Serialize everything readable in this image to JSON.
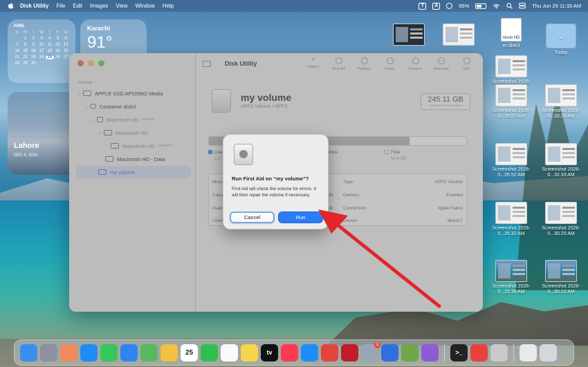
{
  "menubar": {
    "app_name": "Disk Utility",
    "items": [
      "File",
      "Edit",
      "Images",
      "View",
      "Window",
      "Help"
    ],
    "input_badge_1": "T",
    "input_badge_2": "A",
    "battery": "55%",
    "datetime": "Thu Jun 25  11:33 AM"
  },
  "widgets": {
    "calendar": {
      "month": "JUNE",
      "weekdays": [
        "S",
        "M",
        "T",
        "W",
        "T",
        "F",
        "S"
      ],
      "rows": [
        [
          "",
          "1",
          "2",
          "3",
          "4",
          "5",
          "6"
        ],
        [
          "7",
          "8",
          "9",
          "10",
          "11",
          "12",
          "13"
        ],
        [
          "14",
          "15",
          "16",
          "17",
          "18",
          "19",
          "20"
        ],
        [
          "21",
          "22",
          "23",
          "24",
          "25",
          "26",
          "27"
        ],
        [
          "28",
          "29",
          "30",
          "",
          "",
          "",
          ""
        ]
      ],
      "today": "25"
    },
    "weather": {
      "city": "Karachi",
      "temp": "91°"
    },
    "photo": {
      "place": "Lahore",
      "date": "DEC 4, 2023"
    }
  },
  "desktop_icons": [
    {
      "label": "",
      "kind": "thumb-dark"
    },
    {
      "label": "",
      "kind": "thumb"
    },
    {
      "label": "er disk3",
      "kind": "doc",
      "doc_label": "ntosh HD"
    },
    {
      "label": "Today",
      "kind": "folder"
    },
    {
      "label": "Screenshot 2026-0...30.02 AM",
      "kind": "thumb"
    },
    {
      "label": "Screenshot 2026-0...26.57 AM",
      "kind": "thumb"
    },
    {
      "label": "Screenshot 2026-0...33.24 AM",
      "kind": "thumb"
    },
    {
      "label": "Screenshot 2026-0...26.52 AM",
      "kind": "thumb"
    },
    {
      "label": "Screenshot 2026-0...32.33 AM",
      "kind": "thumb"
    },
    {
      "label": "Screenshot 2026-0...26.32 AM",
      "kind": "thumb"
    },
    {
      "label": "Screenshot 2026-0...30.20 AM",
      "kind": "thumb"
    },
    {
      "label": "Screenshot 2026-0...25.38 AM",
      "kind": "thumb-scene"
    },
    {
      "label": "Screenshot 2026-0...30.10 AM",
      "kind": "thumb-scene"
    }
  ],
  "window": {
    "title": "Disk Utility",
    "sidebar": {
      "section": "Internal",
      "items": [
        {
          "label": "APPLE SSD AP0256Q Media",
          "tag": ""
        },
        {
          "label": "Container disk3",
          "tag": ""
        },
        {
          "label": "Macintosh HD",
          "tag": "volumes"
        },
        {
          "label": "Macintosh HD",
          "tag": ""
        },
        {
          "label": "Macintosh HD",
          "tag": "snapshot"
        },
        {
          "label": "Macintosh HD - Data",
          "tag": ""
        },
        {
          "label": "my volume",
          "tag": ""
        }
      ]
    },
    "toolbar_tools": [
      "Volume",
      "First Aid",
      "Partition",
      "Erase",
      "Restore",
      "Unmount",
      "Info"
    ],
    "volume": {
      "name": "my volume",
      "subtitle": "APFS Volume • APFS",
      "capacity": "245.11 GB",
      "shared": "SHARED BY 6 VOLUMES"
    },
    "usage": {
      "used_fraction": 0.78,
      "legend": [
        {
          "label": "Used",
          "value": "1.1",
          "color": "#4a7fd8"
        },
        {
          "label": "Other Volumes",
          "value": "",
          "color": "#a8a8a8"
        },
        {
          "label": "Free",
          "value": "54.6 GB",
          "color": "#f4f4f4"
        }
      ]
    },
    "info_left_labels": [
      "Mount",
      "Capa",
      "Avail",
      "Used"
    ],
    "info_left_values": [
      "",
      "GB",
      "GB",
      "MB"
    ],
    "info_right": [
      {
        "label": "Type:",
        "value": "APFS Volume"
      },
      {
        "label": "Owners:",
        "value": "Enabled"
      },
      {
        "label": "Connection:",
        "value": "Apple Fabric"
      },
      {
        "label": "Device:",
        "value": "disk3s7"
      }
    ]
  },
  "dialog": {
    "title": "Run First Aid on “my volume”?",
    "body": "First Aid will check the volume for errors. It will then repair the volume if necessary.",
    "cancel_label": "Cancel",
    "run_label": "Run"
  },
  "colors": {
    "accent": "#2c7cf6",
    "annotation_arrow": "#e3262b"
  },
  "dock": [
    {
      "name": "finder",
      "color": "#3a8ef0",
      "label": ""
    },
    {
      "name": "launchpad",
      "color": "#8e8fa0",
      "label": ""
    },
    {
      "name": "photos-app",
      "color": "#f08a5a",
      "label": ""
    },
    {
      "name": "safari",
      "color": "#1f8bf3",
      "label": ""
    },
    {
      "name": "messages",
      "color": "#35c759",
      "label": ""
    },
    {
      "name": "mail",
      "color": "#2f84f2",
      "label": ""
    },
    {
      "name": "maps",
      "color": "#58b85d",
      "label": ""
    },
    {
      "name": "photos",
      "color": "#f4c043",
      "label": ""
    },
    {
      "name": "calendar",
      "color": "#ffffff",
      "label": "25"
    },
    {
      "name": "facetime",
      "color": "#2fbf4f",
      "label": ""
    },
    {
      "name": "reminders",
      "color": "#fafafa",
      "label": ""
    },
    {
      "name": "notes",
      "color": "#f7d54a",
      "label": ""
    },
    {
      "name": "tv",
      "color": "#111111",
      "label": "tv"
    },
    {
      "name": "music",
      "color": "#fb3a55",
      "label": ""
    },
    {
      "name": "app-store",
      "color": "#1c8ef7",
      "label": ""
    },
    {
      "name": "chrome",
      "color": "#e2453c",
      "label": ""
    },
    {
      "name": "opera",
      "color": "#c11c2a",
      "label": ""
    },
    {
      "name": "notification-app",
      "color": "#9aa6b8",
      "label": "",
      "badge": "1"
    },
    {
      "name": "files-app",
      "color": "#2f6fe0",
      "label": ""
    },
    {
      "name": "grammar-app",
      "color": "#6ea84a",
      "label": ""
    },
    {
      "name": "feedback-app",
      "color": "#8e5bd6",
      "label": ""
    },
    {
      "name": "terminal",
      "color": "#222222",
      "label": ">_"
    },
    {
      "name": "anydesk",
      "color": "#e8413d",
      "label": ""
    },
    {
      "name": "disk-utility",
      "color": "#c9c9c9",
      "label": ""
    },
    {
      "name": "preview",
      "color": "#e9e9e9",
      "label": ""
    },
    {
      "name": "trash",
      "color": "#d4d8dc",
      "label": ""
    }
  ]
}
